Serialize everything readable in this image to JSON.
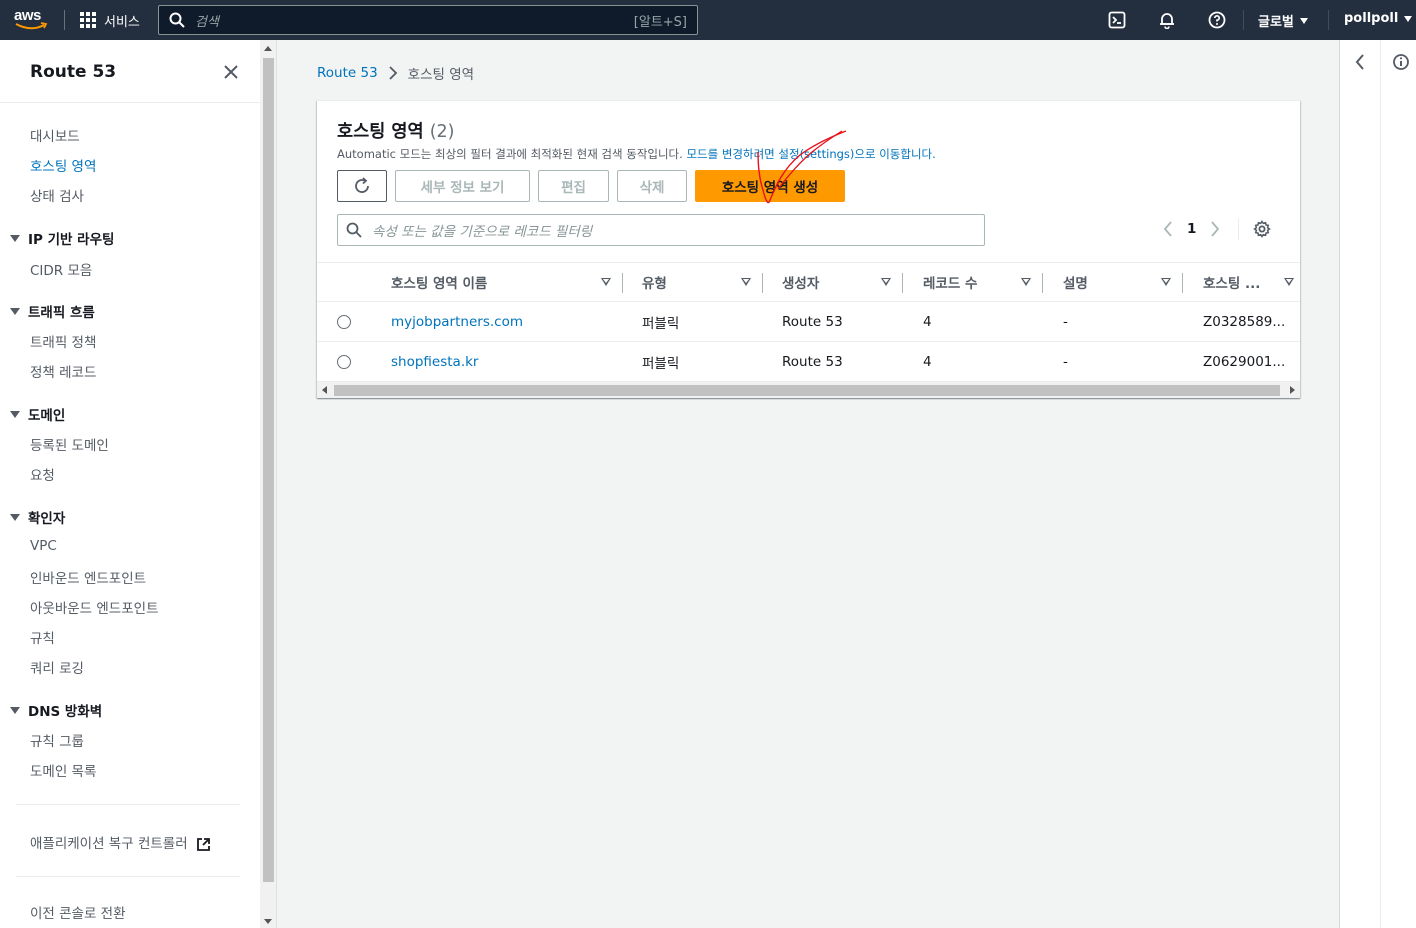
{
  "topnav": {
    "logo_text": "aws",
    "services_label": "서비스",
    "search_placeholder": "검색",
    "search_shortcut": "[알트+S]",
    "region_label": "글로벌",
    "account_label": "pollpoll"
  },
  "sidebar": {
    "title": "Route 53",
    "items_top": [
      {
        "label": "대시보드",
        "active": false
      },
      {
        "label": "호스팅 영역",
        "active": true
      },
      {
        "label": "상태 검사",
        "active": false
      }
    ],
    "sections": [
      {
        "title": "IP 기반 라우팅",
        "items": [
          "CIDR 모음"
        ]
      },
      {
        "title": "트래픽 흐름",
        "items": [
          "트래픽 정책",
          "정책 레코드"
        ]
      },
      {
        "title": "도메인",
        "items": [
          "등록된 도메인",
          "요청"
        ]
      },
      {
        "title": "확인자",
        "items": [
          "VPC",
          "인바운드 엔드포인트",
          "아웃바운드 엔드포인트",
          "규칙",
          "쿼리 로깅"
        ]
      },
      {
        "title": "DNS 방화벽",
        "items": [
          "규칙 그룹",
          "도메인 목록"
        ]
      }
    ],
    "recovery_link": "애플리케이션 복구 컨트롤러",
    "old_console_link": "이전 콘솔로 전환"
  },
  "breadcrumb": {
    "root": "Route 53",
    "current": "호스팅 영역"
  },
  "panel": {
    "title": "호스팅 영역",
    "count": "(2)",
    "desc_prefix": "Automatic 모드는 최상의 필터 결과에 최적화된 현재 검색 동작입니다. ",
    "desc_link": "모드를 변경하려면 설정(settings)으로 이동합니다.",
    "buttons": {
      "details": "세부 정보 보기",
      "edit": "편집",
      "delete": "삭제",
      "create": "호스팅 영역 생성"
    },
    "filter_placeholder": "속성 또는 값을 기준으로 레코드 필터링",
    "page_number": "1"
  },
  "table": {
    "columns": [
      "호스팅 영역 이름",
      "유형",
      "생성자",
      "레코드 수",
      "설명",
      "호스팅 ..."
    ],
    "rows": [
      {
        "name": "myjobpartners.com",
        "type": "퍼블릭",
        "created_by": "Route 53",
        "record_count": "4",
        "description": "-",
        "zone_id": "Z0328589..."
      },
      {
        "name": "shopfiesta.kr",
        "type": "퍼블릭",
        "created_by": "Route 53",
        "record_count": "4",
        "description": "-",
        "zone_id": "Z0629001..."
      }
    ]
  },
  "colors": {
    "nav_bg": "#232f3e",
    "link": "#0073bb",
    "primary_button": "#ff9900",
    "annotation": "#e8101a"
  }
}
